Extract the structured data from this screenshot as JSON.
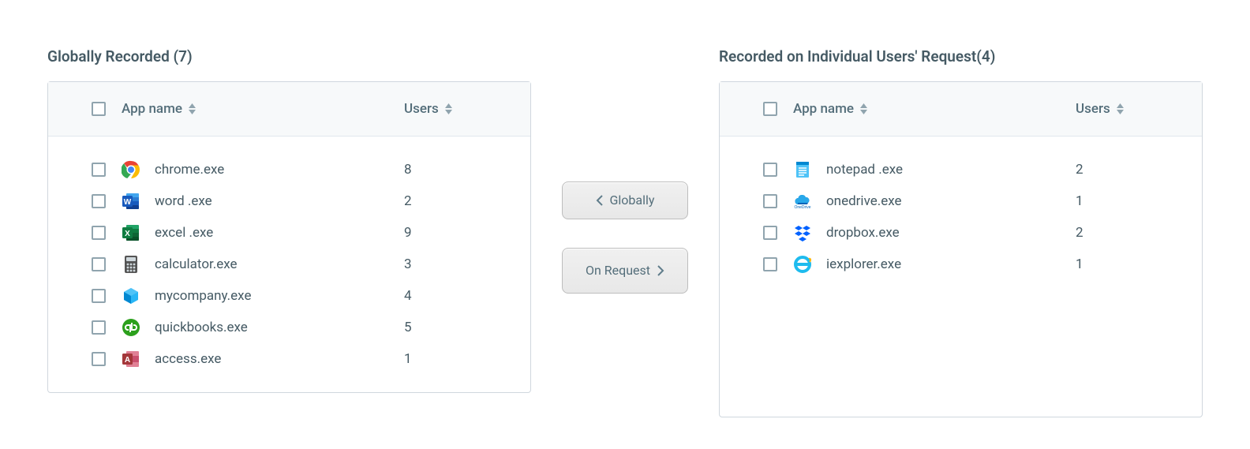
{
  "left": {
    "title": "Globally Recorded (7)",
    "columns": {
      "app": "App name",
      "users": "Users"
    },
    "rows": [
      {
        "icon": "chrome",
        "name": "chrome.exe",
        "users": "8"
      },
      {
        "icon": "word",
        "name": "word .exe",
        "users": "2"
      },
      {
        "icon": "excel",
        "name": "excel .exe",
        "users": "9"
      },
      {
        "icon": "calculator",
        "name": "calculator.exe",
        "users": "3"
      },
      {
        "icon": "box",
        "name": "mycompany.exe",
        "users": "4"
      },
      {
        "icon": "quickbooks",
        "name": "quickbooks.exe",
        "users": "5"
      },
      {
        "icon": "access",
        "name": "access.exe",
        "users": "1"
      }
    ]
  },
  "right": {
    "title": "Recorded on Individual Users' Request(4)",
    "columns": {
      "app": "App name",
      "users": "Users"
    },
    "rows": [
      {
        "icon": "notepad",
        "name": "notepad .exe",
        "users": "2"
      },
      {
        "icon": "onedrive",
        "name": "onedrive.exe",
        "users": "1"
      },
      {
        "icon": "dropbox",
        "name": "dropbox.exe",
        "users": "2"
      },
      {
        "icon": "ie",
        "name": "iexplorer.exe",
        "users": "1"
      }
    ]
  },
  "buttons": {
    "globally": "Globally",
    "onrequest": "On Request"
  }
}
